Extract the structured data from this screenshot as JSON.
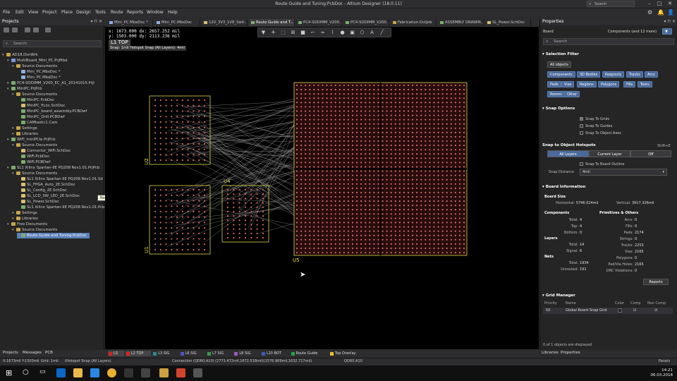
{
  "window": {
    "title": "Route Guide and Tuning.PcbDoc - Altium Designer (18.0.11)",
    "search_placeholder": "Search"
  },
  "menu": [
    "File",
    "Edit",
    "View",
    "Project",
    "Place",
    "Design",
    "Tools",
    "Route",
    "Reports",
    "Window",
    "Help"
  ],
  "projects_panel": {
    "title": "Projects",
    "search_placeholder": "Search",
    "tree": [
      {
        "label": "AD18.DsnWrk",
        "indent": 0,
        "icon": "workspace",
        "color": "#c9a64a"
      },
      {
        "label": "MultiBoard_Mini_PC.PrjMbd",
        "indent": 1,
        "icon": "project",
        "color": "#7a9ad8"
      },
      {
        "label": "Source Documents",
        "indent": 2,
        "icon": "folder",
        "color": "#c9a64a"
      },
      {
        "label": "Mini_PC.MbsDoc *",
        "indent": 3,
        "icon": "doc",
        "color": "#8fb0e0"
      },
      {
        "label": "Mini_PC.MbaDoc *",
        "indent": 3,
        "icon": "doc",
        "color": "#8fb0e0"
      },
      {
        "label": "PC4-SODIMM_V200_EC_A1_20141015.PrjI",
        "indent": 1,
        "icon": "project",
        "color": "#7ab06a"
      },
      {
        "label": "MiniPC.PrjPcb",
        "indent": 1,
        "icon": "project",
        "color": "#7ab06a"
      },
      {
        "label": "Source Documents",
        "indent": 2,
        "icon": "folder",
        "color": "#c9a64a"
      },
      {
        "label": "MiniPC.PcbDoc",
        "indent": 3,
        "icon": "doc",
        "color": "#7ab06a"
      },
      {
        "label": "MiniPC_Func.SchDoc",
        "indent": 3,
        "icon": "doc",
        "color": "#d8c070"
      },
      {
        "label": "MiniPC_board_assembly.PCBDwf",
        "indent": 3,
        "icon": "doc",
        "color": "#7ab06a"
      },
      {
        "label": "MiniPC_Drill.PCBDwf",
        "indent": 3,
        "icon": "doc",
        "color": "#7ab06a"
      },
      {
        "label": "CAMtastic1.Cam",
        "indent": 3,
        "icon": "doc",
        "color": "#7ab06a"
      },
      {
        "label": "Settings",
        "indent": 2,
        "icon": "folder",
        "color": "#c9a64a"
      },
      {
        "label": "Libraries",
        "indent": 2,
        "icon": "folder",
        "color": "#c9a64a"
      },
      {
        "label": "WiFi_miniPCIe.PrjPcb",
        "indent": 1,
        "icon": "project",
        "color": "#7ab06a"
      },
      {
        "label": "Source Documents",
        "indent": 2,
        "icon": "folder",
        "color": "#c9a64a"
      },
      {
        "label": "Connector_WiFi.SchDoc",
        "indent": 3,
        "icon": "doc",
        "color": "#d8c070"
      },
      {
        "label": "WiFi.PcbDoc",
        "indent": 3,
        "icon": "doc",
        "color": "#7ab06a"
      },
      {
        "label": "WiFi.PCBDwf",
        "indent": 3,
        "icon": "doc",
        "color": "#7ab06a"
      },
      {
        "label": "SL1 Xilinx Spartan-IIE PQ208 Rev1.01.PrjPcb",
        "indent": 1,
        "icon": "project",
        "color": "#7ab06a"
      },
      {
        "label": "Source Documents",
        "indent": 2,
        "icon": "folder",
        "color": "#c9a64a"
      },
      {
        "label": "SL1 Xilinx Spartan-IIE PQ208 Rev1.01.Sd",
        "indent": 3,
        "icon": "doc",
        "color": "#d8c070"
      },
      {
        "label": "SL_FPGA_Auto_2E.SchDoc",
        "indent": 3,
        "icon": "doc",
        "color": "#d8c070"
      },
      {
        "label": "SL_Config_2E.SchDoc",
        "indent": 3,
        "icon": "doc",
        "color": "#d8c070"
      },
      {
        "label": "SL_LCD_SW_LED_2E.SchDoc",
        "indent": 3,
        "icon": "doc",
        "color": "#d8c070"
      },
      {
        "label": "SL_Power.SchDoc",
        "indent": 3,
        "icon": "doc",
        "color": "#d8c070"
      },
      {
        "label": "SL1 Xilinx Spartan-IIE PQ208 Rev1.01.Pcb",
        "indent": 3,
        "icon": "doc",
        "color": "#7ab06a"
      },
      {
        "label": "Settings",
        "indent": 2,
        "icon": "folder",
        "color": "#c9a64a"
      },
      {
        "label": "Libraries",
        "indent": 2,
        "icon": "folder",
        "color": "#c9a64a"
      },
      {
        "label": "Free Documents",
        "indent": 1,
        "icon": "folder",
        "color": "#c9a64a"
      },
      {
        "label": "Source Documents",
        "indent": 2,
        "icon": "folder",
        "color": "#c9a64a"
      },
      {
        "label": "Route Guide and Tuning.PcbDoc",
        "indent": 3,
        "icon": "doc",
        "color": "#7ab06a",
        "selected": true
      }
    ],
    "tooltip": "Not in version control",
    "bottom_tabs": [
      "Projects",
      "Messages",
      "PCB"
    ]
  },
  "doc_tabs": [
    {
      "label": "Mini_PC.MbaDoc *",
      "color": "#8fb0e0"
    },
    {
      "label": "Mini_PC.MbsDoc",
      "color": "#8fb0e0"
    },
    {
      "label": "12V_3V3_1V8_Swit...",
      "color": "#d8c070"
    },
    {
      "label": "Route Guide and T...",
      "color": "#7ab06a",
      "active": true
    },
    {
      "label": "PC4-SODIMM_V200...",
      "color": "#7ab06a"
    },
    {
      "label": "PC4-SODIMM_V200...",
      "color": "#7ab06a"
    },
    {
      "label": "Fabrication.OutJob",
      "color": "#c9a64a"
    },
    {
      "label": "ASSEMBLY DRAWIN...",
      "color": "#7ab06a"
    },
    {
      "label": "SL_Power.SchDoc",
      "color": "#d8c070"
    }
  ],
  "canvas": {
    "hud": {
      "line1": "x: 1673.000  dx: 2657.252 mil",
      "line2": "y: 1503.000  dy: 2113.236 mil",
      "layer": "L1 TOP",
      "snap": "Snap: 1mil Hotspot Snap (All Layers): 4mil"
    },
    "components": [
      "U2",
      "U1",
      "U4",
      "U5"
    ]
  },
  "properties": {
    "title": "Properties",
    "object": "Board",
    "object_summary": "Components (and 12 more)",
    "search_placeholder": "Search",
    "selection_filter": {
      "title": "Selection Filter",
      "all": "All objects",
      "items": [
        "Components",
        "3D Bodies",
        "Keepouts",
        "Tracks",
        "Arcs",
        "Pads",
        "Vias",
        "Regions",
        "Polygons",
        "Fills",
        "Texts",
        "Rooms",
        "Other"
      ]
    },
    "snap_options": {
      "title": "Snap Options",
      "checks": [
        {
          "label": "Snap To Grids",
          "checked": true
        },
        {
          "label": "Snap To Guides",
          "checked": false
        },
        {
          "label": "Snap To Object Axes",
          "checked": false
        }
      ]
    },
    "hotspots": {
      "title": "Snap to Object Hotspots",
      "shortcut": "Shift+E",
      "segments": [
        "All Layers",
        "Current Layer",
        "Off"
      ],
      "board_outline": "Snap To Board Outline",
      "distance_label": "Snap Distance",
      "distance_value": "4mil"
    },
    "board_info": {
      "title": "Board Information",
      "board_size": "Board Size",
      "horizontal_label": "Horizontal:",
      "horizontal": "5746.024mil",
      "vertical_label": "Vertical:",
      "vertical": "3917.326mil",
      "components_title": "Components",
      "components": [
        [
          "Total:",
          "4"
        ],
        [
          "Top:",
          "4"
        ],
        [
          "Bottom:",
          "0"
        ]
      ],
      "layers_title": "Layers",
      "layers": [
        [
          "Total:",
          "14"
        ],
        [
          "Signal:",
          "6"
        ]
      ],
      "nets_title": "Nets",
      "nets": [
        [
          "Total:",
          "1934"
        ],
        [
          "Unrouted:",
          "191"
        ]
      ],
      "prims_title": "Primitives & Others",
      "prims": [
        [
          "Arcs:",
          "0"
        ],
        [
          "Fills:",
          "0"
        ],
        [
          "Pads:",
          "2174"
        ],
        [
          "Strings:",
          "0"
        ],
        [
          "Tracks:",
          "2253"
        ],
        [
          "Vias:",
          "2165"
        ],
        [
          "Polygons:",
          "0"
        ],
        [
          "Pad/Via Holes:",
          "2165"
        ],
        [
          "DRC Violations:",
          "0"
        ]
      ],
      "reports_button": "Reports"
    },
    "grid_manager": {
      "title": "Grid Manager",
      "headers": [
        "Priority",
        "Name",
        "Color",
        "Comp",
        "Non Comp"
      ],
      "row": {
        "priority": "50",
        "name": "Global Board Snap Grid"
      }
    },
    "footer": "0 of 1 objects are displayed",
    "bottom_tabs": [
      "Libraries",
      "Properties"
    ],
    "panels_button": "Panels"
  },
  "layer_tabs": [
    {
      "label": "LS",
      "color": "#e02020",
      "active": true
    },
    {
      "label": "L1 TOP",
      "color": "#e02020",
      "active": true
    },
    {
      "label": "L3 SIG",
      "color": "#2f8a8a"
    },
    {
      "label": "L6 SIG",
      "color": "#5050c0"
    },
    {
      "label": "L7 SIG",
      "color": "#3a9a4a"
    },
    {
      "label": "L8 SIG",
      "color": "#9a5ac0"
    },
    {
      "label": "L10 BOT",
      "color": "#3a60c0"
    },
    {
      "label": "Route Guide",
      "color": "#2aa04a"
    },
    {
      "label": "Top Overlay",
      "color": "#e8c030"
    }
  ],
  "status": {
    "coords": "X:1673mil Y:1503mil",
    "grid": "Grid: 1mil",
    "snap": "(Hotspot Snap (All Layers)",
    "connection": "Connection (QDR0.A10) (2773.472mil,1672.518mil)(1576.969mil,1632.717mil)",
    "net": "QDR0.A10"
  },
  "taskbar": {
    "time": "14:21",
    "date": "06.03.2018"
  }
}
